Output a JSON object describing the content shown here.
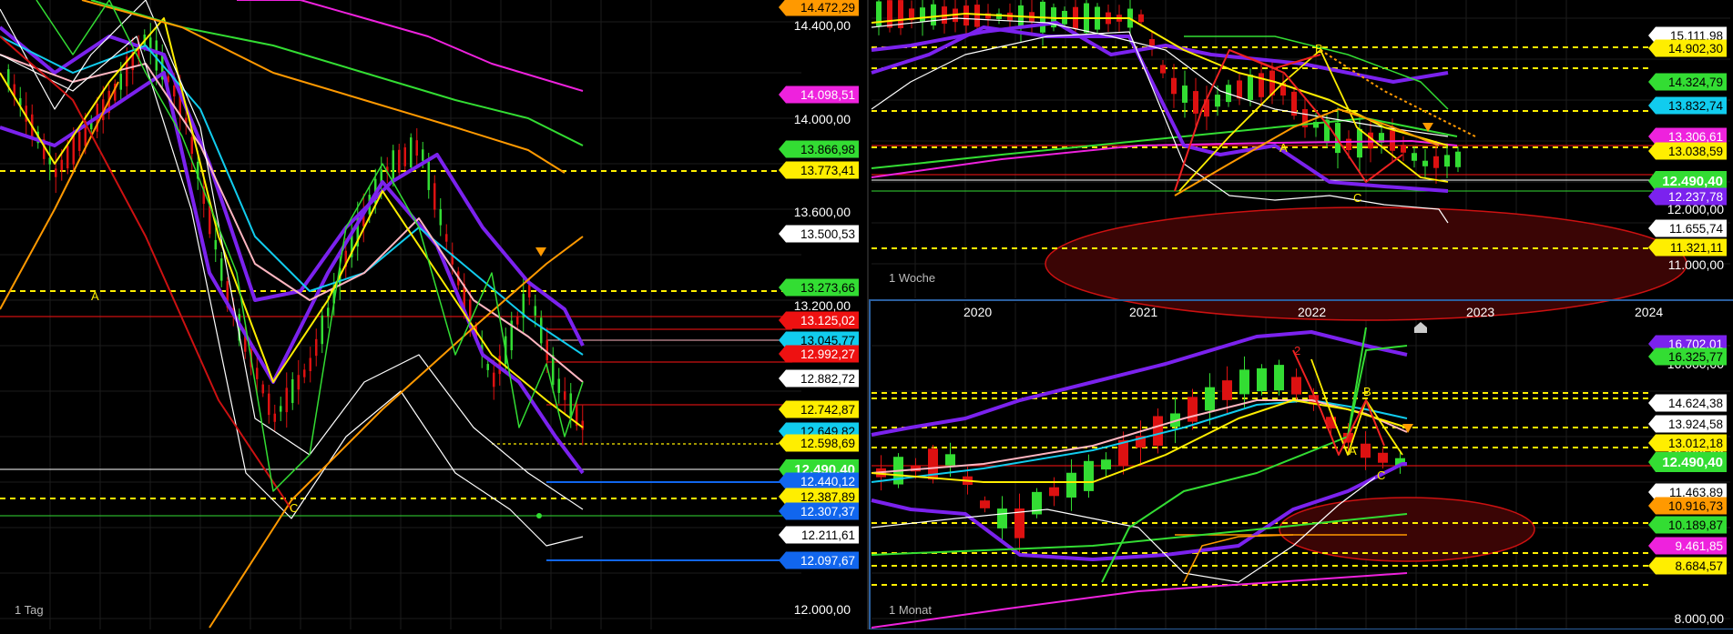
{
  "colors": {
    "background": "#000000",
    "grid": "#1c1c1c",
    "separator": "#2b5f9e",
    "yellow": "#ffee00",
    "white": "#ffffff",
    "purple": "#7b22ee",
    "magenta": "#ee22dd",
    "orange": "#ff9900",
    "red": "#ee1111",
    "green": "#33dd33",
    "cyan": "#11ccee",
    "pink": "#ffb6c1",
    "blue": "#1166ee"
  },
  "charts": [
    {
      "panel_label": "1 Tag",
      "y_axis_labels": [
        "14.400,00",
        "14.000,00",
        "13.600,00",
        "13.200,00",
        "12.000,00"
      ],
      "price_tags": [
        {
          "text": "14.472,29",
          "color": "orange"
        },
        {
          "text": "14.098,51",
          "color": "magenta"
        },
        {
          "text": "13.866,98",
          "color": "green"
        },
        {
          "text": "13.773,41",
          "color": "yellow"
        },
        {
          "text": "13.500,53",
          "color": "white"
        },
        {
          "text": "13.273,66",
          "color": "green"
        },
        {
          "text": "13.125,02",
          "color": "red"
        },
        {
          "text": "13.045,77",
          "color": "cyan"
        },
        {
          "text": "12.992,27",
          "color": "red"
        },
        {
          "text": "12.882,72",
          "color": "white"
        },
        {
          "text": "12.742,87",
          "color": "yellow"
        },
        {
          "text": "12.649,82",
          "color": "cyan"
        },
        {
          "text": "12.598,69",
          "color": "yellow"
        },
        {
          "text": "12.490,40",
          "color": "green",
          "current": true
        },
        {
          "text": "12.440,12",
          "color": "blue"
        },
        {
          "text": "12.387,89",
          "color": "yellow"
        },
        {
          "text": "12.307,37",
          "color": "blue"
        },
        {
          "text": "12.211,61",
          "color": "white"
        },
        {
          "text": "12.097,67",
          "color": "blue"
        }
      ],
      "wave_labels": [
        "A",
        "C"
      ]
    },
    {
      "panel_label": "1 Woche",
      "y_axis_labels": [
        "12.000,00",
        "11.000,00"
      ],
      "price_tags": [
        {
          "text": "15.111,98",
          "color": "white"
        },
        {
          "text": "14.902,30",
          "color": "yellow"
        },
        {
          "text": "14.324,79",
          "color": "green"
        },
        {
          "text": "13.832,74",
          "color": "cyan"
        },
        {
          "text": "13.306,61",
          "color": "magenta"
        },
        {
          "text": "13.038,59",
          "color": "yellow"
        },
        {
          "text": "12.490,40",
          "color": "green",
          "current": true
        },
        {
          "text": "12.237,78",
          "color": "purple"
        },
        {
          "text": "11.655,74",
          "color": "white"
        },
        {
          "text": "11.321,11",
          "color": "yellow"
        }
      ],
      "wave_labels": [
        "B",
        "A",
        "C"
      ]
    },
    {
      "panel_label": "1 Monat",
      "x_axis_labels": [
        "2020",
        "2021",
        "2022",
        "2023",
        "2024"
      ],
      "y_axis_labels": [
        "16.000,00",
        "12.000,00",
        "8.000,00"
      ],
      "price_tags": [
        {
          "text": "16.702,01",
          "color": "purple"
        },
        {
          "text": "16.325,77",
          "color": "green"
        },
        {
          "text": "14.624,38",
          "color": "white"
        },
        {
          "text": "13.924,58",
          "color": "white"
        },
        {
          "text": "13.012,18",
          "color": "yellow"
        },
        {
          "text": "12.490,40",
          "color": "green",
          "current": true
        },
        {
          "text": "11.463,89",
          "color": "white"
        },
        {
          "text": "10.916,73",
          "color": "orange"
        },
        {
          "text": "10.189,87",
          "color": "green"
        },
        {
          "text": "9.461,85",
          "color": "magenta"
        },
        {
          "text": "8.684,57",
          "color": "yellow"
        }
      ],
      "wave_labels": [
        "2",
        "B",
        "A",
        "C"
      ]
    }
  ]
}
